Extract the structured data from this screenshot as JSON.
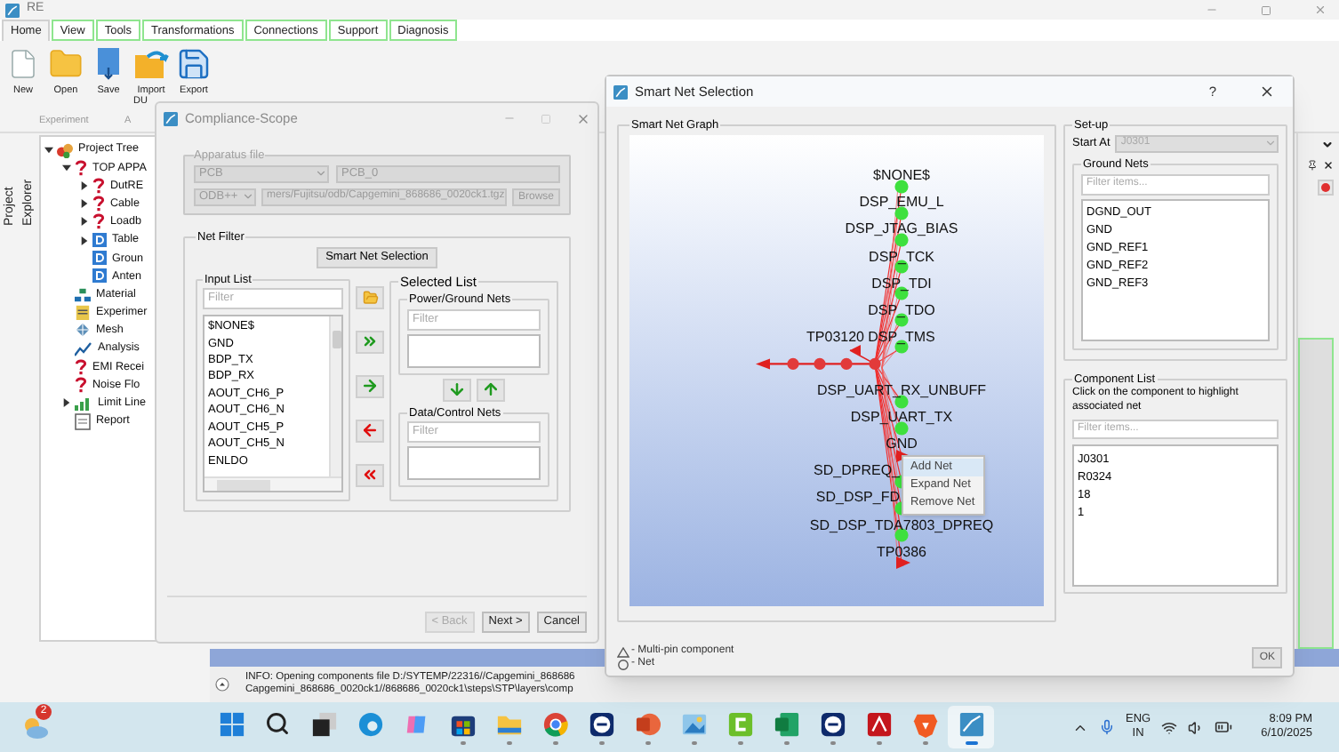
{
  "app": {
    "title": "RE"
  },
  "menu_tabs": [
    {
      "label": "Home",
      "selected": true
    },
    {
      "label": "View",
      "selected": false
    },
    {
      "label": "Tools",
      "selected": false
    },
    {
      "label": "Transformations",
      "selected": false
    },
    {
      "label": "Connections",
      "selected": false
    },
    {
      "label": "Support",
      "selected": false
    },
    {
      "label": "Diagnosis",
      "selected": false
    }
  ],
  "ribbon": {
    "buttons": [
      {
        "kind": "new",
        "label": "New"
      },
      {
        "kind": "open",
        "label": "Open"
      },
      {
        "kind": "save",
        "label": "Save"
      },
      {
        "kind": "import",
        "label": "Import",
        "sublabel": "DU"
      },
      {
        "kind": "export",
        "label": "Export"
      }
    ],
    "groups": [
      "Experiment",
      "A"
    ]
  },
  "side_tab": "Project Explorer",
  "project_tree": [
    {
      "label": "Project Tree",
      "kind": "root",
      "expanded": true,
      "children": [
        {
          "label": "TOP APPA",
          "kind": "unknown",
          "expanded": true,
          "children": [
            {
              "label": "DutRE",
              "kind": "unknown",
              "expanded": false
            },
            {
              "label": "Cable",
              "kind": "unknown",
              "expanded": false
            },
            {
              "label": "Loadb",
              "kind": "unknown",
              "expanded": false
            },
            {
              "label": "Table",
              "kind": "document",
              "expanded": false
            },
            {
              "label": "Groun",
              "kind": "document"
            },
            {
              "label": "Anten",
              "kind": "document"
            }
          ]
        },
        {
          "label": "Material",
          "kind": "material"
        },
        {
          "label": "Experimer",
          "kind": "experiment"
        },
        {
          "label": "Mesh",
          "kind": "mesh"
        },
        {
          "label": "Analysis",
          "kind": "analysis"
        },
        {
          "label": "EMI Recei",
          "kind": "unknown"
        },
        {
          "label": "Noise Flo",
          "kind": "unknown"
        },
        {
          "label": "Limit Line",
          "kind": "chart",
          "expanded": false
        },
        {
          "label": "Report",
          "kind": "report"
        }
      ]
    }
  ],
  "log": [
    "INFO: Opening components file D:/SYTEMP/22316//Capgemini_868686",
    "Capgemini_868686_0020ck1//868686_0020ck1\\steps\\STP\\layers\\comp"
  ],
  "compliance_dialog": {
    "title": "Compliance-Scope",
    "apparatus_file": {
      "legend": "Apparatus file",
      "disabled": true,
      "type_select": "PCB",
      "name_field": "PCB_0",
      "format_select": "ODB++",
      "path_field": "mers/Fujitsu/odb/Capgemini_868686_0020ck1.tgz",
      "browse": "Browse"
    },
    "net_filter": {
      "legend": "Net Filter",
      "smart_button": "Smart Net Selection",
      "input_list": {
        "legend": "Input List",
        "placeholder": "Filter",
        "items": [
          "$NONE$",
          "GND",
          "BDP_TX",
          "BDP_RX",
          "AOUT_CH6_P",
          "AOUT_CH6_N",
          "AOUT_CH5_P",
          "AOUT_CH5_N",
          "ENLDO"
        ]
      },
      "selected_list": {
        "legend": "Selected List",
        "power_ground": {
          "legend": "Power/Ground Nets",
          "placeholder": "Filter"
        },
        "data_control": {
          "legend": "Data/Control Nets",
          "placeholder": "Filter"
        }
      }
    },
    "buttons": [
      {
        "label": "< Back",
        "disabled": true
      },
      {
        "label": "Next >",
        "disabled": false
      },
      {
        "label": "Cancel",
        "disabled": false
      }
    ]
  },
  "smart_dialog": {
    "title": "Smart Net Selection",
    "help": "?",
    "graph": {
      "legend": "Smart Net Graph",
      "rows": [
        {
          "label": "$NONE$",
          "kind": "net"
        },
        {
          "label": "DSP_EMU_L",
          "kind": "net"
        },
        {
          "label": "DSP_JTAG_BIAS",
          "kind": "net"
        },
        {
          "label": "DSP_TCK",
          "kind": "net"
        },
        {
          "label": "DSP_TDI",
          "kind": "net"
        },
        {
          "label": "DSP_TDO",
          "kind": "net"
        },
        {
          "label": "DSP_TMS",
          "kind": "net"
        },
        {
          "label": "DSP_UART_RX_UNBUFF",
          "kind": "net"
        },
        {
          "label": "DSP_UART_TX",
          "kind": "net"
        },
        {
          "label": "GND",
          "kind": "component"
        },
        {
          "label": "SD_DPREQ_",
          "kind": "net",
          "partial": true
        },
        {
          "label": "SD_DSP_FD",
          "kind": "net",
          "partial": true
        },
        {
          "label": "SD_DSP_TDA7803_DPREQ",
          "kind": "net"
        },
        {
          "label": "TP0386",
          "kind": "component"
        }
      ],
      "side_component": "TP03120",
      "context_menu": [
        {
          "label": "Add Net",
          "selected": true
        },
        {
          "label": "Expand Net",
          "selected": false
        },
        {
          "label": "Remove Net",
          "selected": false
        }
      ]
    },
    "setup": {
      "legend": "Set-up",
      "start_at_label": "Start At",
      "start_at_value": "J0301",
      "ground_nets": {
        "legend": "Ground Nets",
        "placeholder": "Filter items...",
        "items": [
          "DGND_OUT",
          "GND",
          "GND_REF1",
          "GND_REF2",
          "GND_REF3"
        ]
      }
    },
    "component_list": {
      "legend": "Component List",
      "hint": "Click on the component to highlight associated net",
      "placeholder": "Filter items...",
      "items": [
        "J0301",
        "R0324",
        "18",
        "1"
      ]
    },
    "legend_items": [
      {
        "kind": "component",
        "label": "- Multi-pin component"
      },
      {
        "kind": "net",
        "label": "- Net"
      }
    ],
    "ok": "OK"
  },
  "taskbar": {
    "weather_badge": "2",
    "apps": [
      {
        "kind": "start",
        "running": false,
        "active": false
      },
      {
        "kind": "search",
        "running": false,
        "active": false
      },
      {
        "kind": "taskview",
        "running": false,
        "active": false
      },
      {
        "kind": "edge",
        "running": false,
        "active": false
      },
      {
        "kind": "copilot",
        "running": false,
        "active": false
      },
      {
        "kind": "store",
        "running": true,
        "active": false
      },
      {
        "kind": "explorer",
        "running": true,
        "active": false
      },
      {
        "kind": "chrome",
        "running": true,
        "active": false
      },
      {
        "kind": "remote",
        "running": true,
        "active": false
      },
      {
        "kind": "powerpoint",
        "running": true,
        "active": false
      },
      {
        "kind": "photos",
        "running": true,
        "active": false
      },
      {
        "kind": "camtasia",
        "running": true,
        "active": false
      },
      {
        "kind": "excel",
        "running": true,
        "active": false
      },
      {
        "kind": "remote",
        "running": true,
        "active": false
      },
      {
        "kind": "acrobat",
        "running": true,
        "active": false
      },
      {
        "kind": "brave",
        "running": true,
        "active": false
      },
      {
        "kind": "re",
        "running": true,
        "active": true
      }
    ],
    "language": [
      "ENG",
      "IN"
    ],
    "time": "8:09 PM",
    "date": "6/10/2025"
  }
}
